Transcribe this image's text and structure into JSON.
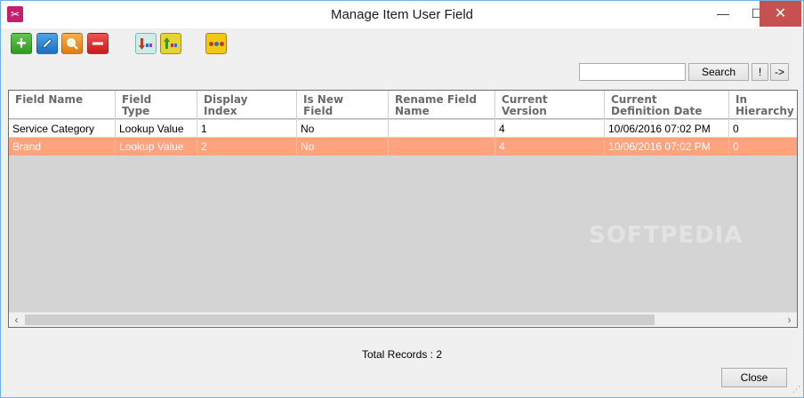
{
  "window": {
    "title": "Manage Item User Field",
    "controls": {
      "minimize": "—",
      "maximize": "☐",
      "close": "✕"
    }
  },
  "toolbar": {
    "buttons": [
      {
        "name": "add",
        "icon": "plus-icon",
        "glyph": "+"
      },
      {
        "name": "edit",
        "icon": "pencil-icon"
      },
      {
        "name": "find",
        "icon": "magnifier-icon"
      },
      {
        "name": "delete",
        "icon": "minus-icon"
      },
      {
        "name": "move-down",
        "icon": "move-down-icon"
      },
      {
        "name": "move-up",
        "icon": "move-up-icon"
      },
      {
        "name": "hierarchy",
        "icon": "dots-icon"
      }
    ]
  },
  "search": {
    "value": "",
    "button_label": "Search",
    "exclaim_label": "!",
    "arrow_label": "->"
  },
  "grid": {
    "columns": [
      "Field Name",
      "Field\nType",
      "Display\nIndex",
      "Is New\nField",
      "Rename Field\nName",
      "Current\nVersion",
      "Current\nDefinition Date",
      "In\nHierarchy"
    ],
    "rows": [
      [
        "Service Category",
        "Lookup Value",
        "1",
        "No",
        "",
        "4",
        "10/06/2016 07:02 PM",
        "0"
      ],
      [
        "Brand",
        "Lookup Value",
        "2",
        "No",
        "",
        "4",
        "10/06/2016 07:02 PM",
        "0"
      ]
    ],
    "selected_row": 1,
    "scroll": {
      "left": "‹",
      "right": "›",
      "position": 0.0
    }
  },
  "footer": {
    "total_records": "Total Records : 2",
    "close_label": "Close"
  },
  "watermark": "SOFTPEDIA",
  "colors": {
    "selected_row": "#ffa37f",
    "close_hover": "#c75050",
    "app_icon": "#c31f6e"
  }
}
